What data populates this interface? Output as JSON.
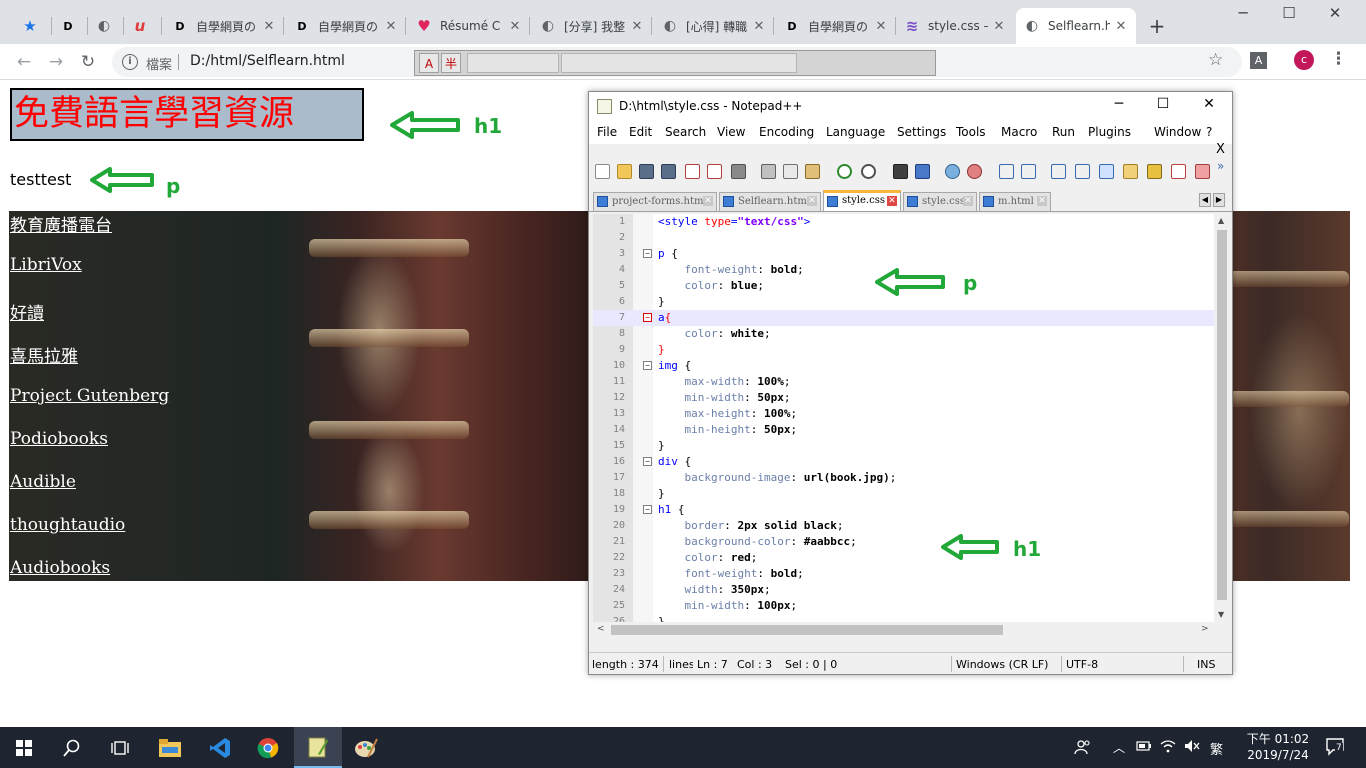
{
  "browser": {
    "tabs": [
      {
        "favicon": "★",
        "title": ""
      },
      {
        "favicon": "D",
        "title": ""
      },
      {
        "favicon": "◐",
        "title": ""
      },
      {
        "favicon": "u",
        "title": ""
      },
      {
        "favicon": "D",
        "title": "自學網頁の"
      },
      {
        "favicon": "D",
        "title": "自學網頁の"
      },
      {
        "favicon": "♥",
        "title": "Résumé C"
      },
      {
        "favicon": "◐",
        "title": "[分享] 我整"
      },
      {
        "favicon": "◐",
        "title": "[心得] 轉職"
      },
      {
        "favicon": "D",
        "title": "自學網頁の"
      },
      {
        "favicon": "≋",
        "title": "style.css –"
      },
      {
        "favicon": "◐",
        "title": "Selflearn.h"
      }
    ],
    "new_tab": "+",
    "window_controls": {
      "minimize": "─",
      "maximize": "☐",
      "close": "✕"
    },
    "nav": {
      "back": "←",
      "forward": "→",
      "reload": "↻"
    },
    "address": {
      "info_icon": "i",
      "label": "檔案",
      "url": "D:/html/Selflearn.html"
    },
    "ime": {
      "key1": "A",
      "key2": "半"
    },
    "bookmark_star": "☆",
    "extension_badge": "A",
    "profile_initial": "c",
    "menu": "⋮"
  },
  "page": {
    "h1": "免費語言學習資源",
    "p": "testtest",
    "links": [
      "教育廣播電台",
      "LibriVox",
      "好讀",
      "喜馬拉雅",
      "Project Gutenberg",
      "Podiobooks",
      "Audible",
      "thoughtaudio",
      "Audiobooks"
    ]
  },
  "annotations": {
    "h1": "h1",
    "p": "p",
    "css_p": "p",
    "css_h1": "h1"
  },
  "notepad": {
    "title": "D:\\html\\style.css - Notepad++",
    "window_controls": {
      "minimize": "─",
      "maximize": "☐",
      "close": "✕"
    },
    "menu": [
      "File",
      "Edit",
      "Search",
      "View",
      "Encoding",
      "Language",
      "Settings",
      "Tools",
      "Macro",
      "Run",
      "Plugins",
      "Window",
      "?"
    ],
    "close_doc": "X",
    "toolbar_more": "»",
    "file_tabs": [
      "project-forms.html",
      "Selflearn.html",
      "style.css",
      "style.css",
      "m.html"
    ],
    "code": [
      {
        "n": "1",
        "fold": "",
        "parts": [
          [
            "c-tag",
            "<style "
          ],
          [
            "c-attr",
            "type"
          ],
          [
            "c-tag",
            "="
          ],
          [
            "c-str",
            "\"text/css\""
          ],
          [
            "c-tag",
            ">"
          ]
        ]
      },
      {
        "n": "2",
        "fold": "",
        "parts": []
      },
      {
        "n": "3",
        "fold": "−",
        "parts": [
          [
            "c-sel",
            "p "
          ],
          [
            "c-brace",
            "{"
          ]
        ]
      },
      {
        "n": "4",
        "fold": "",
        "parts": [
          [
            "c-prop",
            "    font-weight"
          ],
          [
            "c-brace",
            ": "
          ],
          [
            "c-val",
            "bold"
          ],
          [
            "c-brace",
            ";"
          ]
        ]
      },
      {
        "n": "5",
        "fold": "",
        "parts": [
          [
            "c-prop",
            "    color"
          ],
          [
            "c-brace",
            ": "
          ],
          [
            "c-val",
            "blue"
          ],
          [
            "c-brace",
            ";"
          ]
        ]
      },
      {
        "n": "6",
        "fold": "",
        "parts": [
          [
            "c-brace",
            "}"
          ]
        ]
      },
      {
        "n": "7",
        "fold": "−",
        "parts": [
          [
            "c-sel",
            "a"
          ],
          [
            "c-attr",
            "{"
          ]
        ]
      },
      {
        "n": "8",
        "fold": "",
        "parts": [
          [
            "c-prop",
            "    color"
          ],
          [
            "c-brace",
            ": "
          ],
          [
            "c-val",
            "white"
          ],
          [
            "c-brace",
            ";"
          ]
        ]
      },
      {
        "n": "9",
        "fold": "",
        "parts": [
          [
            "c-attr",
            "}"
          ]
        ]
      },
      {
        "n": "10",
        "fold": "−",
        "parts": [
          [
            "c-sel",
            "img "
          ],
          [
            "c-brace",
            "{"
          ]
        ]
      },
      {
        "n": "11",
        "fold": "",
        "parts": [
          [
            "c-prop",
            "    max-width"
          ],
          [
            "c-brace",
            ": "
          ],
          [
            "c-val",
            "100%"
          ],
          [
            "c-brace",
            ";"
          ]
        ]
      },
      {
        "n": "12",
        "fold": "",
        "parts": [
          [
            "c-prop",
            "    min-width"
          ],
          [
            "c-brace",
            ": "
          ],
          [
            "c-val",
            "50px"
          ],
          [
            "c-brace",
            ";"
          ]
        ]
      },
      {
        "n": "13",
        "fold": "",
        "parts": [
          [
            "c-prop",
            "    max-height"
          ],
          [
            "c-brace",
            ": "
          ],
          [
            "c-val",
            "100%"
          ],
          [
            "c-brace",
            ";"
          ]
        ]
      },
      {
        "n": "14",
        "fold": "",
        "parts": [
          [
            "c-prop",
            "    min-height"
          ],
          [
            "c-brace",
            ": "
          ],
          [
            "c-val",
            "50px"
          ],
          [
            "c-brace",
            ";"
          ]
        ]
      },
      {
        "n": "15",
        "fold": "",
        "parts": [
          [
            "c-brace",
            "}"
          ]
        ]
      },
      {
        "n": "16",
        "fold": "−",
        "parts": [
          [
            "c-sel",
            "div "
          ],
          [
            "c-brace",
            "{"
          ]
        ]
      },
      {
        "n": "17",
        "fold": "",
        "parts": [
          [
            "c-prop",
            "    background-image"
          ],
          [
            "c-brace",
            ": "
          ],
          [
            "c-val",
            "url(book.jpg)"
          ],
          [
            "c-brace",
            ";"
          ]
        ]
      },
      {
        "n": "18",
        "fold": "",
        "parts": [
          [
            "c-brace",
            "}"
          ]
        ]
      },
      {
        "n": "19",
        "fold": "−",
        "parts": [
          [
            "c-sel",
            "h1 "
          ],
          [
            "c-brace",
            "{"
          ]
        ]
      },
      {
        "n": "20",
        "fold": "",
        "parts": [
          [
            "c-prop",
            "    border"
          ],
          [
            "c-brace",
            ": "
          ],
          [
            "c-val",
            "2px solid black"
          ],
          [
            "c-brace",
            ";"
          ]
        ]
      },
      {
        "n": "21",
        "fold": "",
        "parts": [
          [
            "c-prop",
            "    background-color"
          ],
          [
            "c-brace",
            ": "
          ],
          [
            "c-val",
            "#aabbcc"
          ],
          [
            "c-brace",
            ";"
          ]
        ]
      },
      {
        "n": "22",
        "fold": "",
        "parts": [
          [
            "c-prop",
            "    color"
          ],
          [
            "c-brace",
            ": "
          ],
          [
            "c-val",
            "red"
          ],
          [
            "c-brace",
            ";"
          ]
        ]
      },
      {
        "n": "23",
        "fold": "",
        "parts": [
          [
            "c-prop",
            "    font-weight"
          ],
          [
            "c-brace",
            ": "
          ],
          [
            "c-val",
            "bold"
          ],
          [
            "c-brace",
            ";"
          ]
        ]
      },
      {
        "n": "24",
        "fold": "",
        "parts": [
          [
            "c-prop",
            "    width"
          ],
          [
            "c-brace",
            ": "
          ],
          [
            "c-val",
            "350px"
          ],
          [
            "c-brace",
            ";"
          ]
        ]
      },
      {
        "n": "25",
        "fold": "",
        "parts": [
          [
            "c-prop",
            "    min-width"
          ],
          [
            "c-brace",
            ": "
          ],
          [
            "c-val",
            "100px"
          ],
          [
            "c-brace",
            ";"
          ]
        ]
      },
      {
        "n": "26",
        "fold": "",
        "parts": [
          [
            "c-brace",
            "}"
          ]
        ]
      }
    ],
    "current_line": 7,
    "status": {
      "length": "length : 374",
      "lines": "lines",
      "ln": "Ln : 7",
      "col": "Col : 3",
      "sel": "Sel : 0 | 0",
      "eol": "Windows (CR LF)",
      "encoding": "UTF-8",
      "mode": "INS"
    }
  },
  "taskbar": {
    "tray_lang": "繁",
    "time": "下午 01:02",
    "date": "2019/7/24",
    "notifications": "7"
  },
  "colors": {
    "annotation_green": "#22a838",
    "h1_bg": "#aabbcc",
    "h1_text": "#ff0000",
    "chrome_strip": "#dee1e6",
    "taskbar": "#1e2430"
  }
}
